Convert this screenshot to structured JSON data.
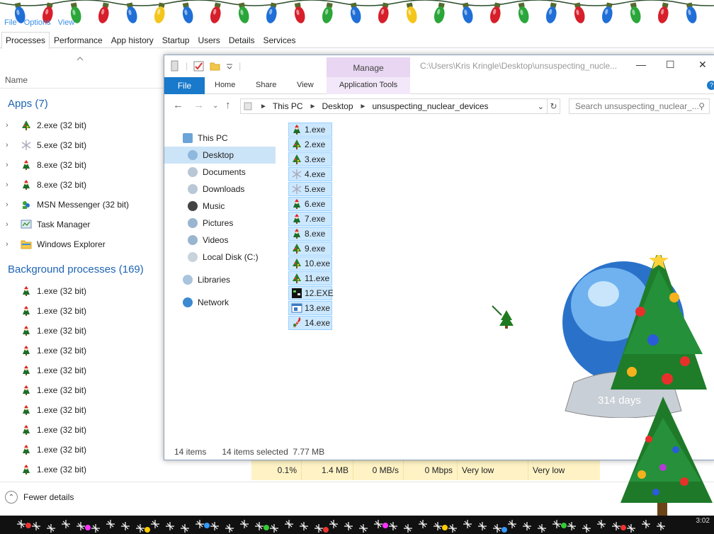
{
  "colors": {
    "accent": "#1979ca",
    "group_header": "#1e64b4",
    "selection": "#cce8ff",
    "manage_tab": "#e8d6f2",
    "metrics_highlight": "#fff3c6"
  },
  "task_manager": {
    "menu": [
      "File",
      "Options",
      "View"
    ],
    "tabs": [
      "Processes",
      "Performance",
      "App history",
      "Startup",
      "Users",
      "Details",
      "Services"
    ],
    "column_name": "Name",
    "apps_header": "Apps (7)",
    "apps": [
      {
        "name": "2.exe (32 bit)",
        "icon": "tree-icon"
      },
      {
        "name": "5.exe (32 bit)",
        "icon": "snowflake-icon"
      },
      {
        "name": "8.exe (32 bit)",
        "icon": "santa-icon"
      },
      {
        "name": "8.exe (32 bit)",
        "icon": "santa-icon"
      },
      {
        "name": "MSN Messenger (32 bit)",
        "icon": "msn-icon"
      },
      {
        "name": "Task Manager",
        "icon": "task-manager-icon"
      },
      {
        "name": "Windows Explorer",
        "icon": "folder-icon"
      }
    ],
    "background_header": "Background processes (169)",
    "background": [
      "1.exe (32 bit)",
      "1.exe (32 bit)",
      "1.exe (32 bit)",
      "1.exe (32 bit)",
      "1.exe (32 bit)",
      "1.exe (32 bit)",
      "1.exe (32 bit)",
      "1.exe (32 bit)",
      "1.exe (32 bit)",
      "1.exe (32 bit)"
    ],
    "row_metrics": {
      "cpu": "0.1%",
      "memory": "1.4 MB",
      "disk": "0 MB/s",
      "network": "0 Mbps",
      "power": "Very low",
      "power_trend": "Very low"
    },
    "fewer_details": "Fewer details"
  },
  "explorer": {
    "manage": "Manage",
    "title": "C:\\Users\\Kris Kringle\\Desktop\\unsuspecting_nucle...",
    "ribbon_tabs": {
      "file": "File",
      "home": "Home",
      "share": "Share",
      "view": "View",
      "app_tools": "Application Tools"
    },
    "breadcrumb": [
      "This PC",
      "Desktop",
      "unsuspecting_nuclear_devices"
    ],
    "search_placeholder": "Search unsuspecting_nuclear_...",
    "nav": {
      "this_pc": "This PC",
      "desktop": "Desktop",
      "documents": "Documents",
      "downloads": "Downloads",
      "music": "Music",
      "pictures": "Pictures",
      "videos": "Videos",
      "local_disk": "Local Disk (C:)",
      "libraries": "Libraries",
      "network": "Network"
    },
    "files": [
      {
        "name": "1.exe",
        "icon": "santa-icon"
      },
      {
        "name": "2.exe",
        "icon": "tree-icon"
      },
      {
        "name": "3.exe",
        "icon": "tree-icon"
      },
      {
        "name": "4.exe",
        "icon": "snowflake-icon"
      },
      {
        "name": "5.exe",
        "icon": "snowflake-icon"
      },
      {
        "name": "6.exe",
        "icon": "santa-icon"
      },
      {
        "name": "7.exe",
        "icon": "santa-icon"
      },
      {
        "name": "8.exe",
        "icon": "santa-icon"
      },
      {
        "name": "9.exe",
        "icon": "tree-icon"
      },
      {
        "name": "10.exe",
        "icon": "tree-icon"
      },
      {
        "name": "11.exe",
        "icon": "tree-icon"
      },
      {
        "name": "12.EXE",
        "icon": "dark-app-icon"
      },
      {
        "name": "13.exe",
        "icon": "window-app-icon"
      },
      {
        "name": "14.exe",
        "icon": "candy-cane-icon"
      }
    ],
    "status_items": "14 items",
    "status_selected": "14 items selected  7.77 MB"
  },
  "decorations": {
    "globe_text": "314 days",
    "clock": "3:02"
  }
}
